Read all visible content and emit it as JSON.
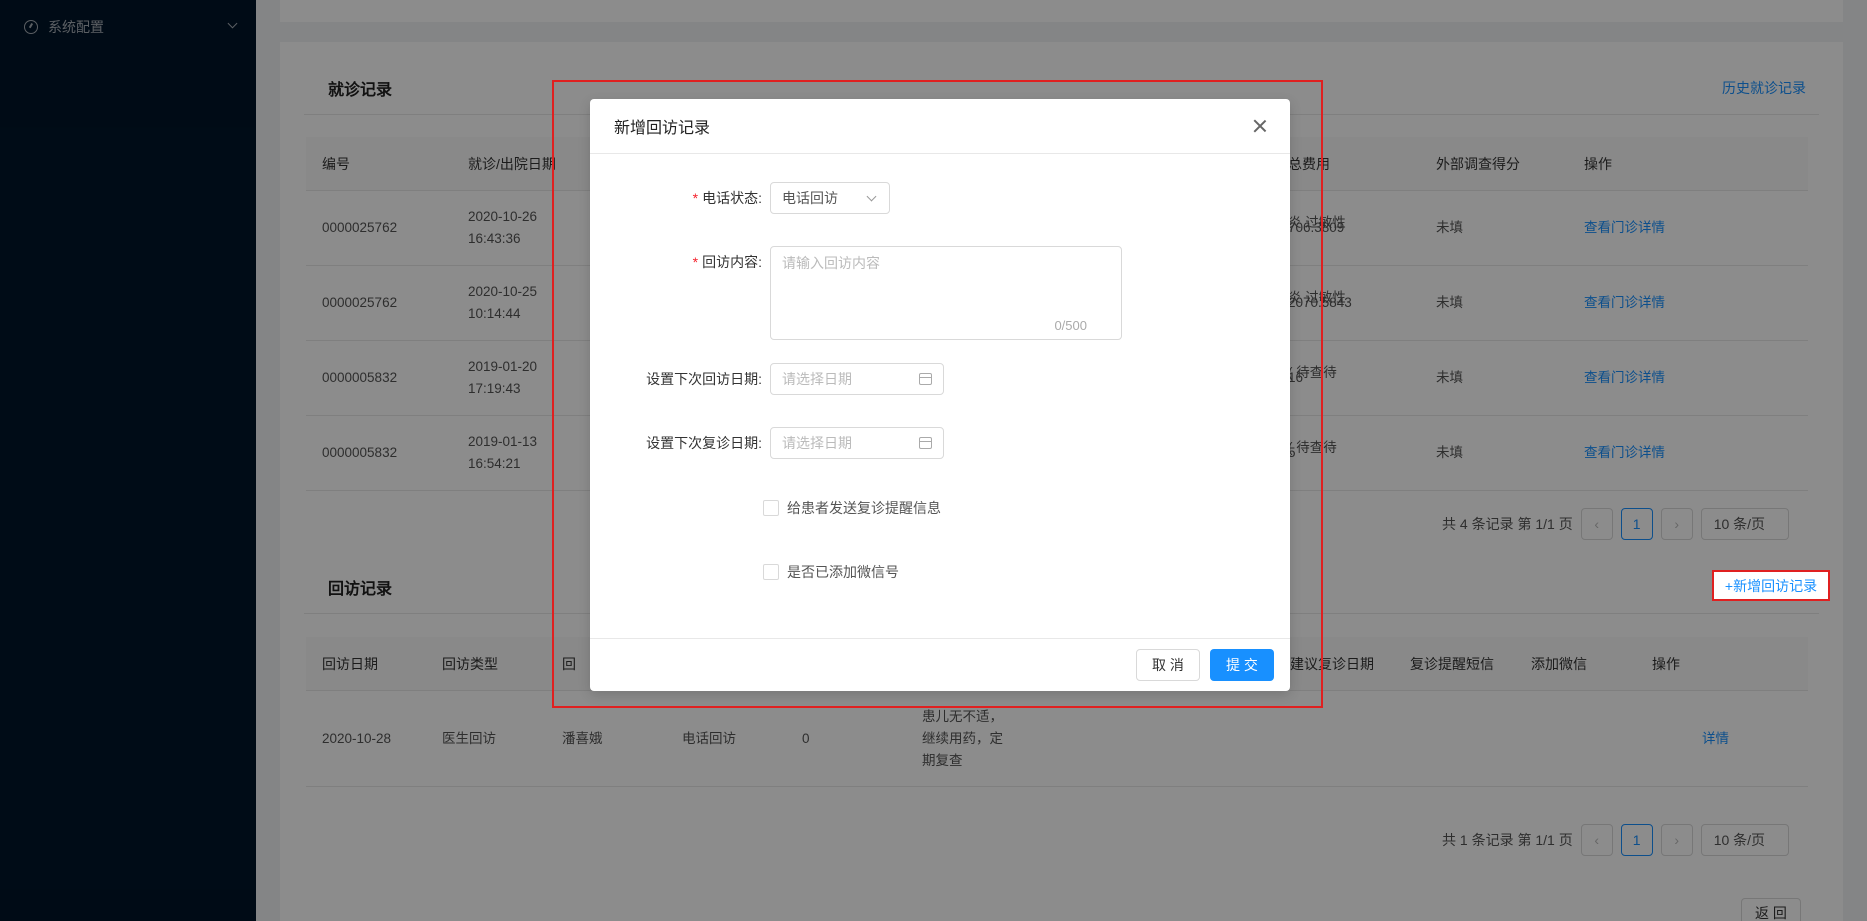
{
  "sidebar": {
    "menu_label": "系统配置"
  },
  "visits": {
    "title": "就诊记录",
    "history_link": "历史就诊记录",
    "columns": [
      "编号",
      "就诊/出院日期",
      "总费用",
      "外部调查得分",
      "操作"
    ],
    "rows": [
      {
        "id": "0000025762",
        "date": "2020-10-26",
        "time": "16:43:36",
        "diag": "炎 过敏性",
        "fee": "706.3809",
        "score": "未填",
        "action": "查看门诊详情"
      },
      {
        "id": "0000025762",
        "date": "2020-10-25",
        "time": "10:14:44",
        "diag": "炎 过敏性",
        "fee": "2070.5843",
        "score": "未填",
        "action": "查看门诊详情"
      },
      {
        "id": "0000005832",
        "date": "2019-01-20",
        "time": "17:19:43",
        "diag": "( 待查待",
        "fee": "16",
        "score": "未填",
        "action": "查看门诊详情"
      },
      {
        "id": "0000005832",
        "date": "2019-01-13",
        "time": "16:54:21",
        "diag": "( 待查待",
        "fee": "5",
        "score": "未填",
        "action": "查看门诊详情"
      }
    ],
    "pager": {
      "summary": "共 4 条记录 第 1/1 页",
      "page": "1",
      "size": "10 条/页"
    }
  },
  "followups": {
    "title": "回访记录",
    "add_link": "+新增回访记录",
    "columns": [
      "回访日期",
      "回访类型",
      "回",
      "建议复诊日期",
      "复诊提醒短信",
      "添加微信",
      "操作"
    ],
    "row": {
      "date": "2020-10-28",
      "type": "医生回访",
      "person": "潘喜娥",
      "method": "电话回访",
      "count": "0",
      "content": "患儿无不适，继续用药，定期复查",
      "action": "详情"
    },
    "pager": {
      "summary": "共 1 条记录 第 1/1 页",
      "page": "1",
      "size": "10 条/页"
    },
    "back": "返 回"
  },
  "modal": {
    "title": "新增回访记录",
    "phone_label": "电话状态:",
    "phone_value": "电话回访",
    "content_label": "回访内容:",
    "content_placeholder": "请输入回访内容",
    "counter": "0/500",
    "next_visit_label": "设置下次回访日期:",
    "next_recheck_label": "设置下次复诊日期:",
    "date_placeholder": "请选择日期",
    "send_reminder": "给患者发送复诊提醒信息",
    "wechat_added": "是否已添加微信号",
    "cancel": "取 消",
    "submit": "提 交"
  }
}
